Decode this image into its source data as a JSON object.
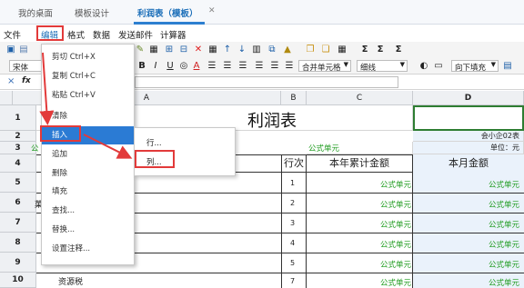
{
  "tabs": [
    {
      "label": "我的桌面"
    },
    {
      "label": "模板设计"
    },
    {
      "label": "利润表（模板）"
    }
  ],
  "close_glyph": "✕",
  "menubar": {
    "items": [
      "文件",
      "编辑",
      "格式",
      "数据",
      "发送邮件",
      "计算器"
    ]
  },
  "toolbar": {
    "font_name": "宋体",
    "merge_cells": "合并单元格",
    "border_style": "细线",
    "fill_direction": "向下填充",
    "icons": [
      "save-icon",
      "bold-icon",
      "italic-icon",
      "underline-icon",
      "font-color-icon",
      "align-left-icon",
      "align-center-icon",
      "align-right-icon",
      "sum-icon",
      "delete-icon",
      "sort-asc-icon",
      "sort-desc-icon"
    ]
  },
  "formula_bar": {
    "cancel": "×",
    "fx": "fx"
  },
  "columns": [
    "A",
    "B",
    "C",
    "D"
  ],
  "rows": [
    "1",
    "2",
    "3",
    "4",
    "5",
    "6",
    "7",
    "8",
    "9",
    "10"
  ],
  "sheet": {
    "title": "利润表",
    "template_no": "会小企02表",
    "unit": "单位：元",
    "formula_unit_c3": "公式单元",
    "left_cut_a3": "公",
    "header_b": "行次",
    "header_c": "本年累计金额",
    "header_d": "本月金额",
    "left_cut_a6": "菓",
    "line_nos": [
      "1",
      "2",
      "3",
      "4",
      "5",
      "6",
      "7"
    ],
    "formula_cell": "公式单元",
    "row10_label": "资源税"
  },
  "edit_menu": {
    "items": [
      "剪切 Ctrl+X",
      "复制 Ctrl+C",
      "粘贴 Ctrl+V",
      "清除",
      "插入",
      "追加",
      "删除",
      "填充",
      "查找...",
      "替换...",
      "设置注释..."
    ],
    "selected": "插入"
  },
  "submenu": {
    "items": [
      "行...",
      "列..."
    ]
  },
  "colors": {
    "accent": "#2b7bd4",
    "highlight": "#e23a3a",
    "formula_green": "#1b9a1b"
  }
}
